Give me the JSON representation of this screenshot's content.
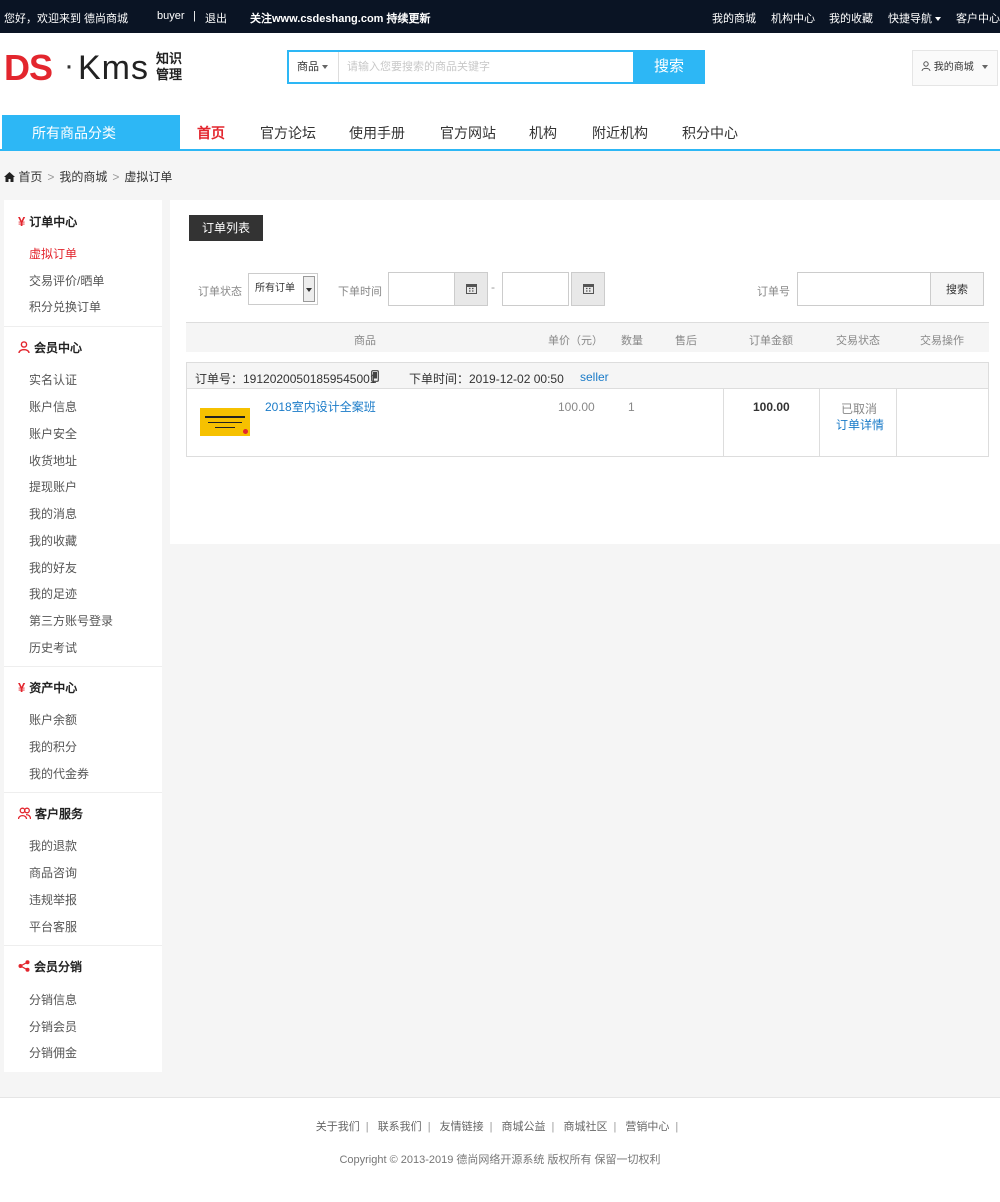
{
  "topbar": {
    "welcome": "您好，欢迎来到  德尚商城",
    "user": "buyer",
    "sep": "|",
    "logout": "退出",
    "notice": "关注www.csdeshang.com 持续更新",
    "links": [
      "我的商城",
      "机构中心",
      "我的收藏",
      "快捷导航",
      "客户中心"
    ]
  },
  "header": {
    "logo_ds": "DS",
    "logo_dot": "·",
    "logo_kms": "Kms",
    "logo_sub": "知识管理",
    "search_category": "商品",
    "search_placeholder": "请输入您要搜索的商品关键字",
    "search_button": "搜索",
    "my_mall": "我的商城"
  },
  "nav": {
    "all_categories": "所有商品分类",
    "items": [
      "首页",
      "官方论坛",
      "使用手册",
      "官方网站",
      "机构",
      "附近机构",
      "积分中心"
    ]
  },
  "breadcrumb": {
    "home": "首页",
    "level1": "我的商城",
    "level2": "虚拟订单",
    "sep": ">"
  },
  "sidebar": {
    "groups": [
      {
        "title": "订单中心",
        "icon": "yen-icon",
        "items": [
          "虚拟订单",
          "交易评价/晒单",
          "积分兑换订单"
        ]
      },
      {
        "title": "会员中心",
        "icon": "user-icon",
        "items": [
          "实名认证",
          "账户信息",
          "账户安全",
          "收货地址",
          "提现账户",
          "我的消息",
          "我的收藏",
          "我的好友",
          "我的足迹",
          "第三方账号登录",
          "历史考试"
        ]
      },
      {
        "title": "资产中心",
        "icon": "yen-icon",
        "items": [
          "账户余额",
          "我的积分",
          "我的代金券"
        ]
      },
      {
        "title": "客户服务",
        "icon": "users-icon",
        "items": [
          "我的退款",
          "商品咨询",
          "违规举报",
          "平台客服"
        ]
      },
      {
        "title": "会员分销",
        "icon": "share-icon",
        "items": [
          "分销信息",
          "分销会员",
          "分销佣金"
        ]
      }
    ]
  },
  "main": {
    "tab": "订单列表",
    "filters": {
      "status_label": "订单状态",
      "status_value": "所有订单",
      "time_label": "下单时间",
      "dash": "-",
      "order_no_label": "订单号",
      "search_button": "搜索"
    },
    "columns": [
      "商品",
      "单价（元）",
      "数量",
      "售后",
      "订单金额",
      "交易状态",
      "交易操作"
    ],
    "order": {
      "order_no": "订单号：19120200501859545001",
      "order_time": "下单时间：2019-12-02 00:50",
      "seller": "seller",
      "product": "2018室内设计全案班",
      "price": "100.00",
      "qty": "1",
      "amount": "100.00",
      "status": "已取消",
      "detail_link": "订单详情"
    }
  },
  "footer": {
    "links": [
      "关于我们",
      "联系我们",
      "友情链接",
      "商城公益",
      "商城社区",
      "营销中心"
    ],
    "copyright": "Copyright © 2013-2019 德尚网络开源系统 版权所有 保留一切权利"
  },
  "colors": {
    "accent": "#2db7f5",
    "brand_red": "#e3262e",
    "topbar": "#0a1424"
  }
}
